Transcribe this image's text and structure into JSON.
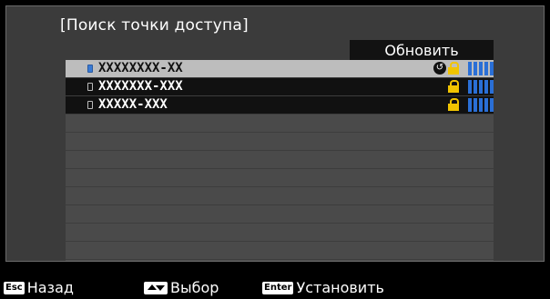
{
  "title": "[Поиск точки доступа]",
  "refresh_label": "Обновить",
  "networks": [
    {
      "ssid": "XXXXXXXX-XX",
      "connected": true,
      "locked": true,
      "signal_bars": 5
    },
    {
      "ssid": "XXXXXXX-XXX",
      "connected": false,
      "locked": true,
      "signal_bars": 5
    },
    {
      "ssid": "XXXXX-XXX",
      "connected": false,
      "locked": true,
      "signal_bars": 5
    }
  ],
  "footer": {
    "back": {
      "key": "Esc",
      "label": "Назад"
    },
    "select": {
      "key": "updown-icon",
      "label": "Выбор"
    },
    "set": {
      "key": "Enter",
      "label": "Установить"
    }
  },
  "colors": {
    "accent_blue": "#2a6fd6",
    "lock_yellow": "#f1c400",
    "selected_row": "#bdbdbd"
  }
}
